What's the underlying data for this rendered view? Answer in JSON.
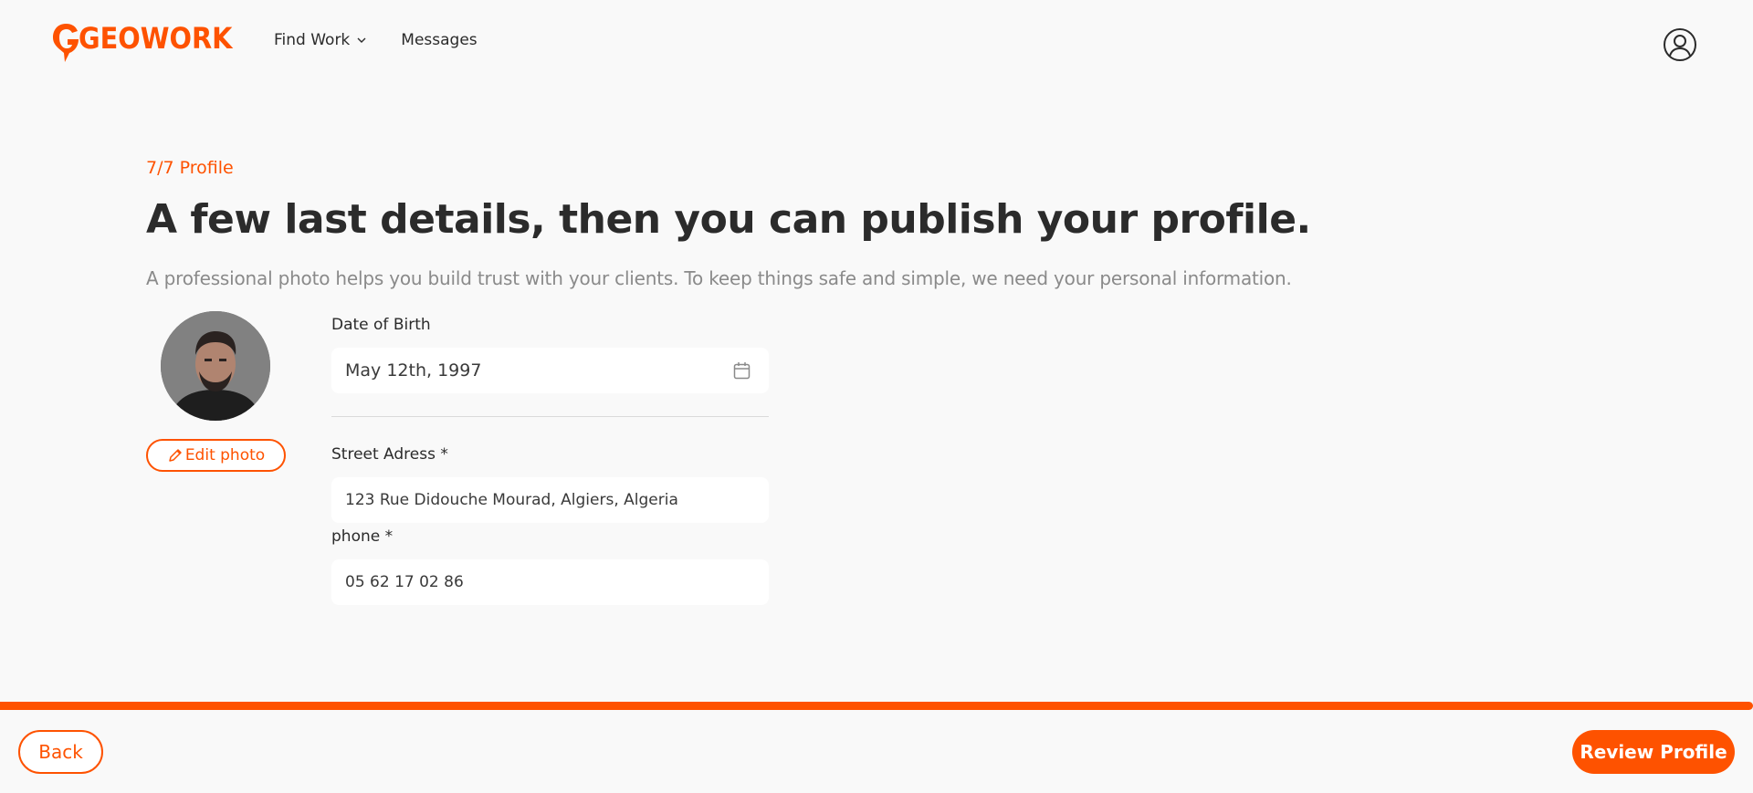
{
  "brand": {
    "name": "GEOWORK",
    "accent_color": "#fe5200"
  },
  "nav": {
    "find_work": "Find Work",
    "messages": "Messages"
  },
  "header": {
    "account_icon": "user-circle-icon"
  },
  "page": {
    "step": "7/7 Profile",
    "title": "A few last details, then you can publish your profile.",
    "subtitle": "A professional photo helps you build trust with your clients. To keep things safe and simple, we need your personal information."
  },
  "photo": {
    "edit_label": "Edit photo"
  },
  "form": {
    "dob": {
      "label": "Date of Birth",
      "value": "May 12th, 1997"
    },
    "street": {
      "label": "Street Adress *",
      "value": "123 Rue Didouche Mourad, Algiers, Algeria"
    },
    "phone": {
      "label": "phone *",
      "value": "05 62 17 02 86"
    }
  },
  "progress": {
    "percent": 100
  },
  "footer": {
    "back_label": "Back",
    "review_label": "Review Profile"
  }
}
